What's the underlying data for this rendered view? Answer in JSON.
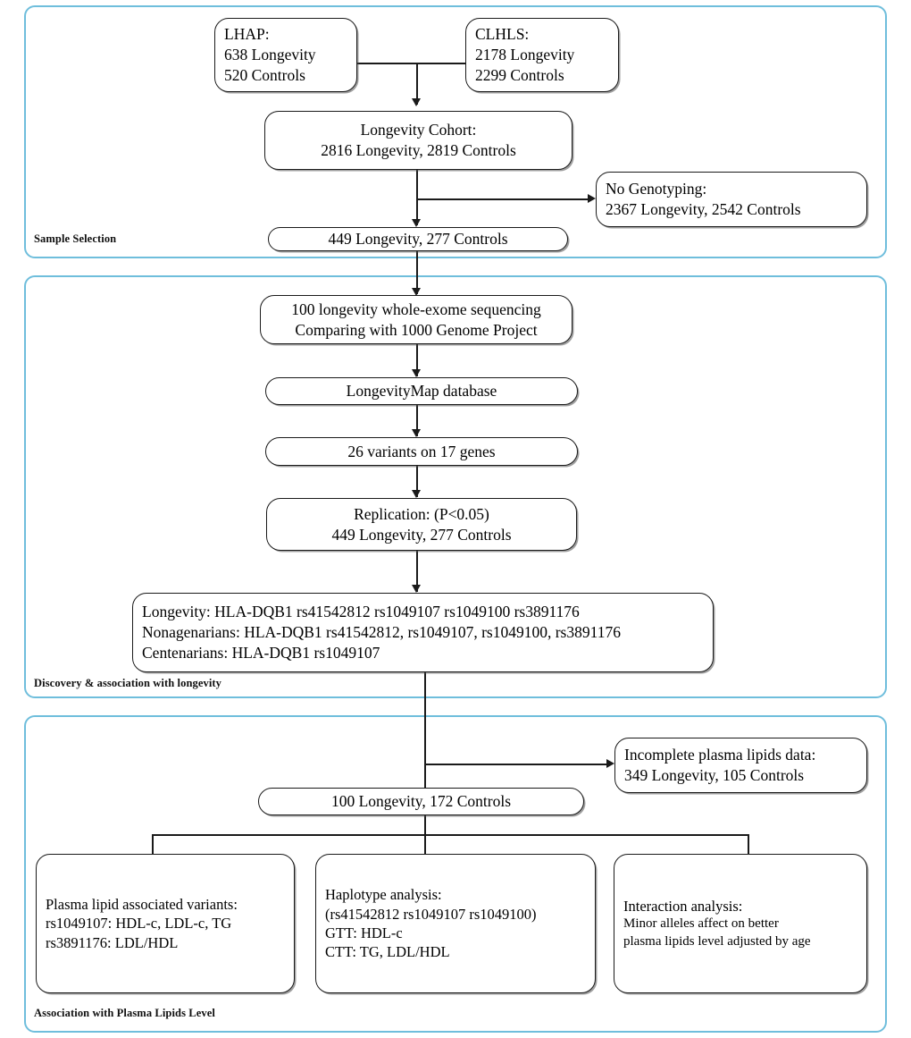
{
  "figure": {
    "type": "flowchart",
    "title": "Longevity study design flowchart"
  },
  "sections": [
    {
      "id": "sample-selection",
      "label": "Sample Selection"
    },
    {
      "id": "discovery",
      "label": "Discovery & association with longevity"
    },
    {
      "id": "plasma-lipids",
      "label": "Association with Plasma Lipids Level"
    }
  ],
  "nodes": {
    "lhap": {
      "lines": [
        "LHAP:",
        "638 Longevity",
        "520 Controls"
      ]
    },
    "clhls": {
      "lines": [
        "CLHLS:",
        "2178 Longevity",
        "2299 Controls"
      ]
    },
    "cohort": {
      "lines": [
        "Longevity Cohort:",
        "2816 Longevity, 2819 Controls"
      ]
    },
    "no_genotyping": {
      "lines": [
        "No Genotyping:",
        "2367 Longevity, 2542 Controls"
      ]
    },
    "genotyped": {
      "lines": [
        "449 Longevity, 277 Controls"
      ]
    },
    "wes": {
      "lines": [
        "100 longevity whole-exome sequencing",
        "Comparing with 1000 Genome Project"
      ]
    },
    "longevitymap": {
      "lines": [
        "LongevityMap database"
      ]
    },
    "variants": {
      "lines": [
        "26 variants on 17 genes"
      ]
    },
    "replication": {
      "lines": [
        "Replication: (P<0.05)",
        "449 Longevity, 277 Controls"
      ]
    },
    "associations": {
      "lines": [
        "Longevity: HLA-DQB1 rs41542812 rs1049107 rs1049100 rs3891176",
        "Nonagenarians: HLA-DQB1 rs41542812, rs1049107, rs1049100, rs3891176",
        "Centenarians: HLA-DQB1 rs1049107"
      ]
    },
    "incomplete_lipids": {
      "lines": [
        "Incomplete plasma lipids data:",
        "349 Longevity, 105 Controls"
      ]
    },
    "lipids_cohort": {
      "lines": [
        "100 Longevity, 172 Controls"
      ]
    },
    "plasma_variants": {
      "lines": [
        "Plasma lipid associated variants:",
        "rs1049107: HDL-c, LDL-c, TG",
        "rs3891176: LDL/HDL"
      ]
    },
    "haplotype": {
      "lines": [
        "Haplotype analysis:",
        "(rs41542812 rs1049107 rs1049100)",
        "GTT: HDL-c",
        "CTT: TG, LDL/HDL"
      ]
    },
    "interaction": {
      "lines": [
        "Interaction analysis:",
        "Minor alleles affect on better",
        "plasma lipids level adjusted by age"
      ]
    }
  },
  "colors": {
    "panel_border": "#6FBEDC",
    "node_border": "#1a1a1a",
    "connector": "#1a1a1a",
    "background": "#ffffff"
  }
}
